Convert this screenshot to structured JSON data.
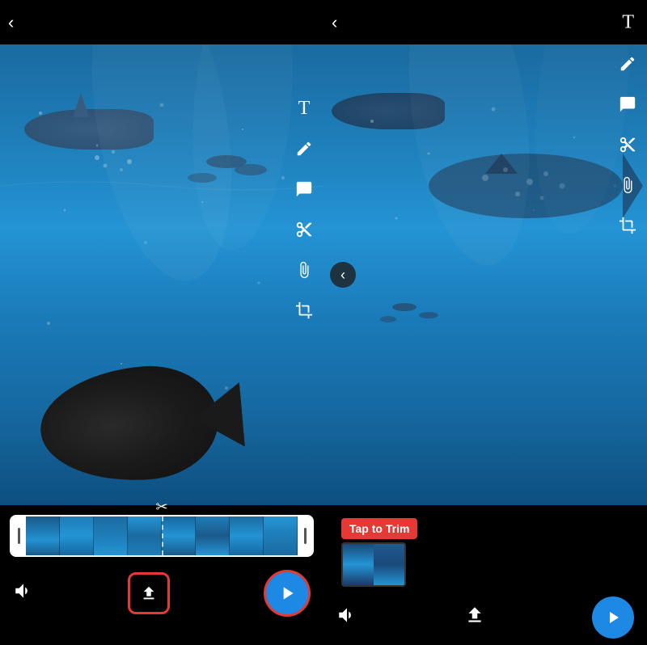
{
  "left_panel": {
    "toolbar": {
      "icons": [
        "T",
        "✏",
        "🗂",
        "✂",
        "🔗",
        "⬛"
      ]
    },
    "bottom": {
      "volume_label": "🔊",
      "share_label": "⬆",
      "play_label": "▶"
    },
    "tap_to_trim_label": "Tap to Trim",
    "tap_to_trim_dash": "—"
  },
  "right_panel": {
    "toolbar": {
      "icons": [
        "T",
        "✏",
        "🗂",
        "✂",
        "🔗",
        "⬛"
      ]
    },
    "bottom": {
      "volume_label": "🔊",
      "share_label": "⬆",
      "play_label": "▶"
    },
    "tap_to_trim_label": "Tap to Trim",
    "tap_to_trim_dash": "—"
  },
  "colors": {
    "accent_red": "#e53935",
    "accent_blue": "#1e88e5",
    "bg": "#000000",
    "text_white": "#ffffff"
  },
  "icons": {
    "back": "‹",
    "text": "T",
    "pencil": "✎",
    "sticker": "⬛",
    "scissors": "✂",
    "link": "⛓",
    "crop": "⬚",
    "volume": "🔊",
    "play": "▶",
    "share": "⬆"
  }
}
